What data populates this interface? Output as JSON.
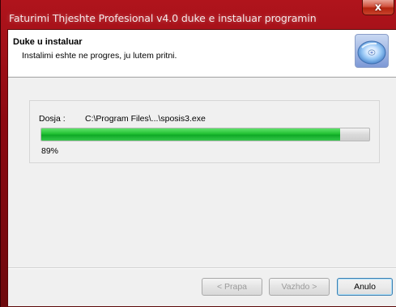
{
  "window": {
    "title": "Faturimi Thjeshte Profesional v4.0 duke e instaluar programin",
    "close_label": "x"
  },
  "header": {
    "title": "Duke u instaluar",
    "subtitle": "Instalimi eshte ne progres, ju lutem pritni."
  },
  "progress": {
    "file_label": "Dosja :",
    "file_path": "C:\\Program Files\\...\\sposis3.exe",
    "percent_text": "89%",
    "fraction": 0.91
  },
  "buttons": {
    "back": "< Prapa",
    "next": "Vazhdo >",
    "cancel": "Anulo"
  }
}
